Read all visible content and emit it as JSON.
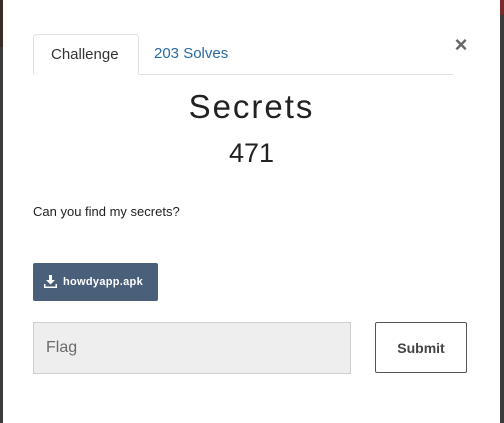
{
  "tabs": {
    "challenge_label": "Challenge",
    "solves_label": "203 Solves"
  },
  "close_glyph": "×",
  "challenge": {
    "name": "Secrets",
    "value": "471",
    "description": "Can you find my secrets?",
    "file_label": "howdyapp.apk",
    "file_icon": "download-icon"
  },
  "flag": {
    "placeholder": "Flag",
    "value": ""
  },
  "submit_label": "Submit",
  "colors": {
    "link": "#2a6aa3",
    "file_button": "#4a5f7a"
  }
}
